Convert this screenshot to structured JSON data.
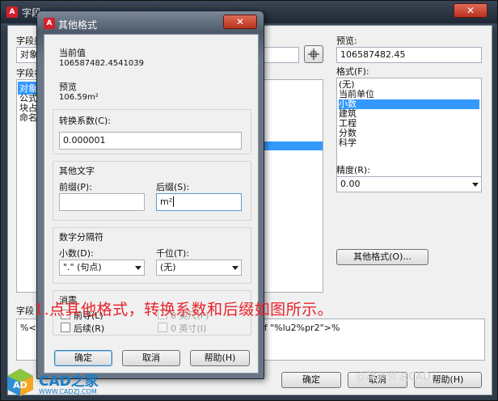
{
  "field_dialog": {
    "title": "字段",
    "close_label": "✕",
    "field_category_label": "字段类别",
    "field_category_value": "对象",
    "field_name_label": "字段名",
    "field_names": [
      "对象",
      "公式",
      "块占",
      "命名"
    ],
    "preview_label": "预览:",
    "preview_value": "106587482.45",
    "format_label": "格式(F):",
    "format_items": [
      "(无)",
      "当前单位",
      "小数",
      "建筑",
      "工程",
      "分数",
      "科学"
    ],
    "selected_format_index": 2,
    "precision_label": "精度(R):",
    "precision_value": "0.00",
    "other_format_button": "其他格式(O)...",
    "field_expression_label": "字段",
    "field_expression_prefix": "%<\\A",
    "field_expression_suffix": "\\f \"%lu2%pr2\">%",
    "ok_button": "确定",
    "cancel_button": "取消",
    "help_button": "帮助(H)"
  },
  "other_format_dialog": {
    "title": "其他格式",
    "close_label": "✕",
    "current_value_label": "当前值",
    "current_value": "106587482.4541039",
    "preview_label": "预览",
    "preview_value": "106.59m²",
    "conversion_factor_label": "转换系数(C):",
    "conversion_factor_value": "0.000001",
    "additional_text_group": "其他文字",
    "prefix_label": "前缀(P):",
    "prefix_value": "",
    "suffix_label": "后缀(S):",
    "suffix_value": "m²",
    "separator_group": "数字分隔符",
    "decimal_label": "小数(D):",
    "decimal_value": "\".\" (句点)",
    "thousands_label": "千位(T):",
    "thousands_value": "(无)",
    "zero_suppression_group": "消零",
    "leading_label": "前导(L)",
    "trailing_label": "后续(R)",
    "zero_feet_label": "0 英尺(F)",
    "zero_inches_label": "0 英寸(I)",
    "ok_button": "确定",
    "cancel_button": "取消",
    "help_button": "帮助(H)"
  },
  "annotation": "1.点其他格式，转换系数和后缀如图所示。",
  "logo": {
    "mark_text": "AD",
    "name": "CAD之家",
    "url": "WWW.CADZJ.COM"
  },
  "watermark_right": "@跳老师说CAD",
  "colors": {
    "accent_red": "#e8232a",
    "selection_blue": "#3399ff",
    "title_dark": "#2f3a48",
    "logo_blue": "#1a7cc5"
  }
}
